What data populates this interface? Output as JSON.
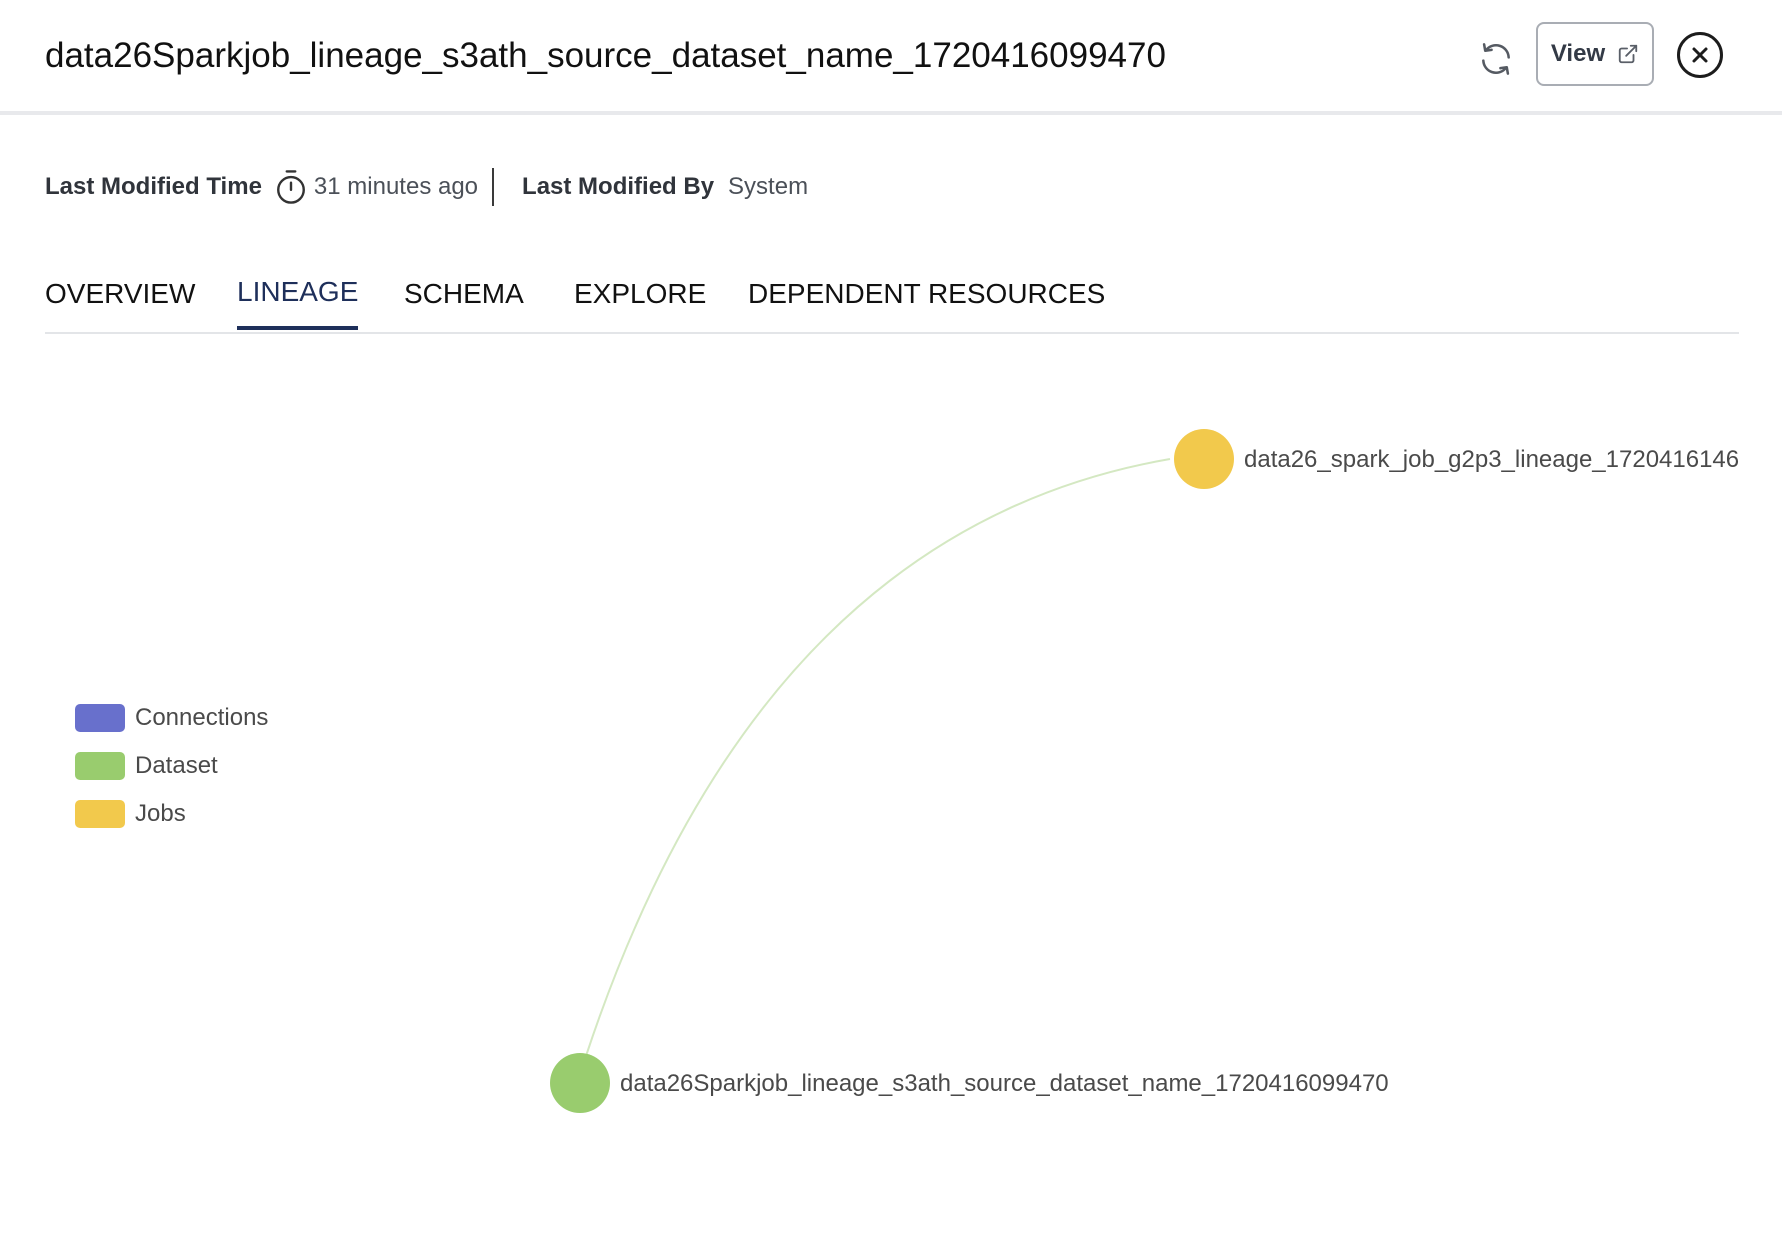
{
  "header": {
    "title": "data26Sparkjob_lineage_s3ath_source_dataset_name_1720416099470",
    "view_label": "View",
    "refresh_icon": "refresh-icon",
    "external_link_icon": "external-link-icon",
    "close_icon": "close-icon"
  },
  "meta": {
    "modified_time_label": "Last Modified Time",
    "modified_time_value": "31 minutes ago",
    "modified_by_label": "Last Modified By",
    "modified_by_value": "System",
    "timer_icon": "timer-icon"
  },
  "tabs": [
    {
      "label": "OVERVIEW",
      "active": false
    },
    {
      "label": "LINEAGE",
      "active": true
    },
    {
      "label": "SCHEMA",
      "active": false
    },
    {
      "label": "EXPLORE",
      "active": false
    },
    {
      "label": "DEPENDENT RESOURCES",
      "active": false
    }
  ],
  "legend": [
    {
      "label": "Connections",
      "color": "#6870cc"
    },
    {
      "label": "Dataset",
      "color": "#99cc6e"
    },
    {
      "label": "Jobs",
      "color": "#f2c94c"
    }
  ],
  "graph": {
    "nodes": [
      {
        "id": "job",
        "type": "Jobs",
        "label": "data26_spark_job_g2p3_lineage_1720416146",
        "color": "#f2c94c"
      },
      {
        "id": "dataset",
        "type": "Dataset",
        "label": "data26Sparkjob_lineage_s3ath_source_dataset_name_1720416099470",
        "color": "#99cc6e"
      }
    ],
    "edges": [
      {
        "from": "dataset",
        "to": "job",
        "color": "#d4e8c2"
      }
    ]
  }
}
